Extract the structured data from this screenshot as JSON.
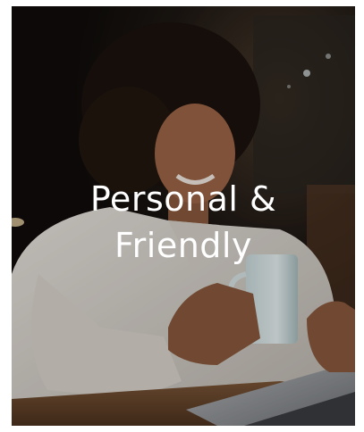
{
  "card": {
    "title_line1": "Personal &",
    "title_line2": "Friendly"
  },
  "colors": {
    "text": "#ffffff",
    "background": "#161210",
    "page": "#ffffff"
  },
  "image": {
    "description": "woman smiling at laptop holding a mug"
  }
}
